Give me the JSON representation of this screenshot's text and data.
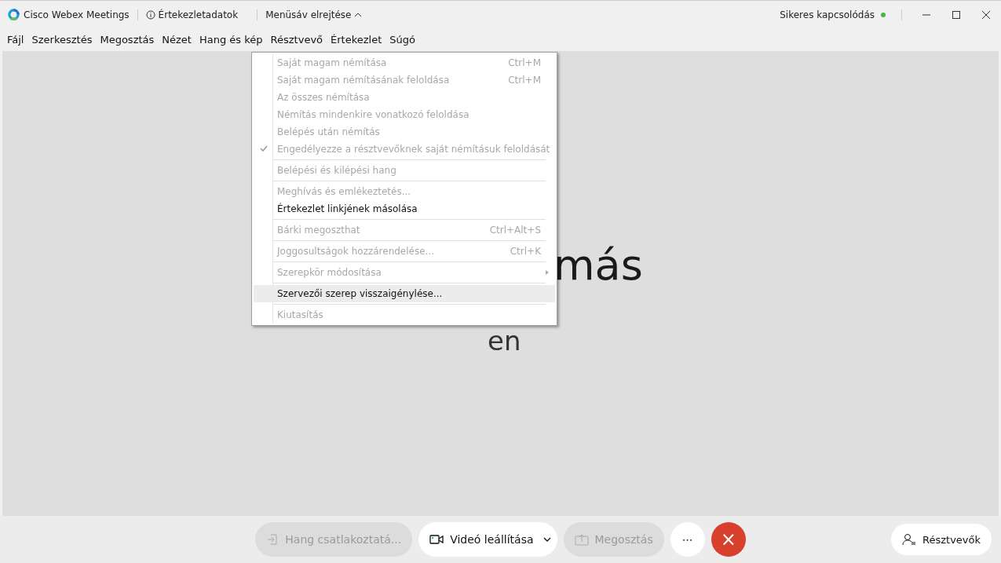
{
  "title_bar": {
    "app_name": "Cisco Webex Meetings",
    "meeting_info": "Értekezletadatok",
    "hide_menu": "Menüsáv elrejtése",
    "status": "Sikeres kapcsolódás"
  },
  "menu_bar": [
    "Fájl",
    "Szerkesztés",
    "Megosztás",
    "Nézet",
    "Hang és kép",
    "Résztvevő",
    "Értekezlet",
    "Súgó"
  ],
  "stage": {
    "texts": [
      "más",
      "en"
    ]
  },
  "menu": {
    "items": [
      {
        "kind": "item",
        "label": "Saját magam némítása",
        "shortcut": "Ctrl+M",
        "disabled": true,
        "checked": false,
        "selected": false
      },
      {
        "kind": "item",
        "label": "Saját magam némításának feloldása",
        "shortcut": "Ctrl+M",
        "disabled": true,
        "checked": false,
        "selected": false
      },
      {
        "kind": "item",
        "label": "Az összes némítása",
        "disabled": true,
        "checked": false,
        "selected": false
      },
      {
        "kind": "item",
        "label": "Némítás mindenkire vonatkozó feloldása",
        "disabled": true,
        "checked": false,
        "selected": false
      },
      {
        "kind": "item",
        "label": "Belépés után némítás",
        "disabled": true,
        "checked": false,
        "selected": false
      },
      {
        "kind": "item",
        "label": "Engedélyezze a résztvevőknek saját némításuk feloldását",
        "disabled": true,
        "checked": true,
        "selected": false
      },
      {
        "kind": "separator"
      },
      {
        "kind": "item",
        "label": "Belépési és kilépési hang",
        "disabled": true,
        "checked": false,
        "selected": false
      },
      {
        "kind": "separator"
      },
      {
        "kind": "item",
        "label": "Meghívás és emlékeztetés...",
        "disabled": true,
        "checked": false,
        "selected": false
      },
      {
        "kind": "item",
        "label": "Értekezlet linkjének másolása",
        "disabled": false,
        "checked": false,
        "selected": false
      },
      {
        "kind": "separator"
      },
      {
        "kind": "item",
        "label": "Bárki megoszthat",
        "shortcut": "Ctrl+Alt+S",
        "disabled": true,
        "checked": false,
        "selected": false
      },
      {
        "kind": "separator"
      },
      {
        "kind": "item",
        "label": "Joggosultságok hozzárendelése...",
        "shortcut": "Ctrl+K",
        "disabled": true,
        "checked": false,
        "selected": false
      },
      {
        "kind": "separator"
      },
      {
        "kind": "item",
        "label": "Szerepkör módosítása",
        "submenu": true,
        "disabled": true,
        "checked": false,
        "selected": false
      },
      {
        "kind": "separator"
      },
      {
        "kind": "item",
        "label": "Szervezői szerep visszaigénylése...",
        "disabled": false,
        "checked": false,
        "selected": true
      },
      {
        "kind": "separator"
      },
      {
        "kind": "item",
        "label": "Kiutasítás",
        "disabled": true,
        "checked": false,
        "selected": false
      }
    ]
  },
  "controls": [
    {
      "kind": "audio",
      "label": "Hang csatlakoztatá...",
      "disabled": true
    },
    {
      "kind": "video",
      "label": "Videó leállítása",
      "disabled": false
    },
    {
      "kind": "share",
      "label": "Megosztás",
      "disabled": true
    },
    {
      "kind": "more",
      "label": "⋯",
      "disabled": false
    },
    {
      "kind": "leave",
      "label": "×",
      "disabled": false
    }
  ],
  "participants_button": "Résztvevők"
}
